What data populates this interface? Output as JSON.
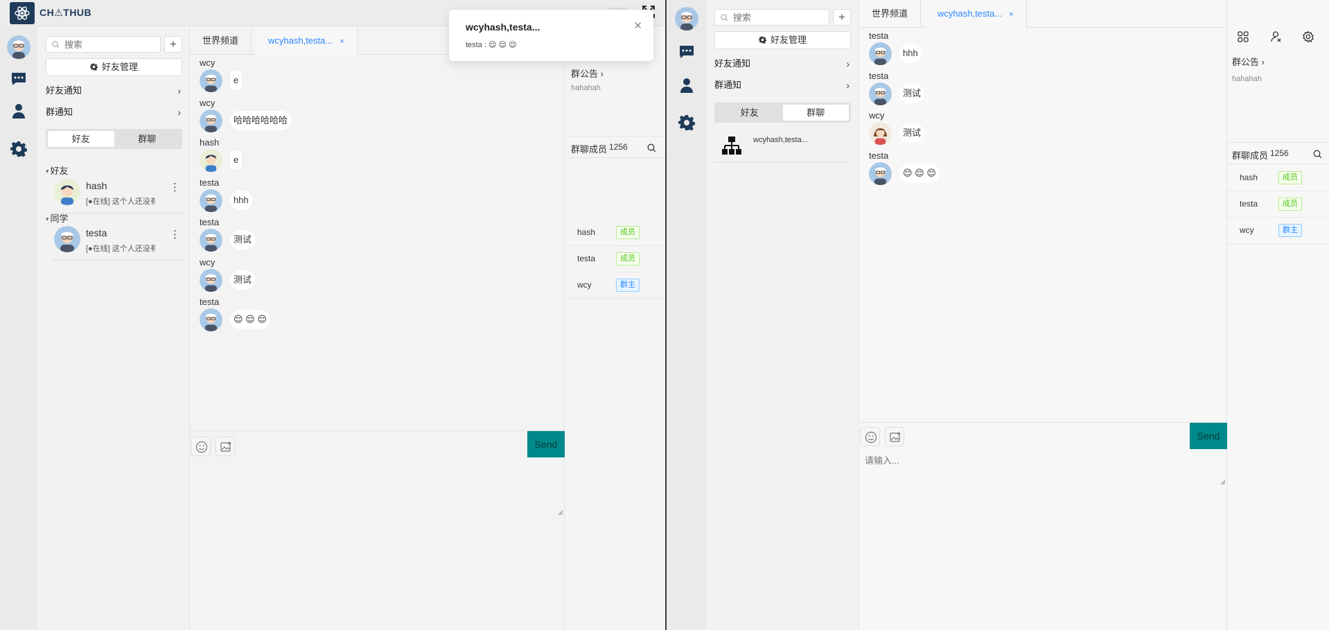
{
  "app": {
    "brand": "CH⚠THUB"
  },
  "notification": {
    "title": "wcyhash,testa...",
    "body": "testa : 😌 😌 😌"
  },
  "contacts": {
    "search_placeholder": "搜索",
    "add_label": "+",
    "manage_label": "好友管理",
    "friend_notice": "好友通知",
    "group_notice": "群通知",
    "seg_friends": "好友",
    "seg_groups": "群聊",
    "groups": [
      {
        "name": "好友",
        "friends": [
          {
            "name": "hash",
            "status": "[●在线] 这个人还没有签名"
          }
        ]
      },
      {
        "name": "同学",
        "friends": [
          {
            "name": "testa",
            "status": "[●在线] 这个人还没有签名"
          }
        ]
      }
    ],
    "group_chats": [
      {
        "name": "wcyhash,testa..."
      }
    ]
  },
  "chat": {
    "tabs": [
      {
        "label": "世界频道"
      },
      {
        "label": "wcyhash,testa...",
        "close": "×"
      }
    ],
    "messages_a": [
      {
        "sender": "wcy",
        "text": "e"
      },
      {
        "sender": "wcy",
        "text": "哈哈哈哈哈哈"
      },
      {
        "sender": "hash",
        "text": "e"
      },
      {
        "sender": "testa",
        "text": "hhh"
      },
      {
        "sender": "testa",
        "text": "测试"
      },
      {
        "sender": "wcy",
        "text": "测试"
      },
      {
        "sender": "testa",
        "text": "😌 😌 😌"
      }
    ],
    "messages_b": [
      {
        "sender": "testa",
        "text": "hhh"
      },
      {
        "sender": "testa",
        "text": "测试"
      },
      {
        "sender": "wcy",
        "text": "测试"
      },
      {
        "sender": "testa",
        "text": "😌 😌 😌"
      }
    ],
    "send_label": "Send",
    "input_placeholder": "请输入..."
  },
  "info": {
    "announcement_title": "群公告 ›",
    "announcement_body": "hahahah",
    "members_title": "群聊成员",
    "members_count": "1256",
    "members": [
      {
        "name": "hash",
        "role": "成员"
      },
      {
        "name": "testa",
        "role": "成员"
      },
      {
        "name": "wcy",
        "role": "群主"
      }
    ]
  },
  "colors": {
    "accent": "#2b86ff",
    "send": "#00898a",
    "brand": "#1f3b5a"
  }
}
